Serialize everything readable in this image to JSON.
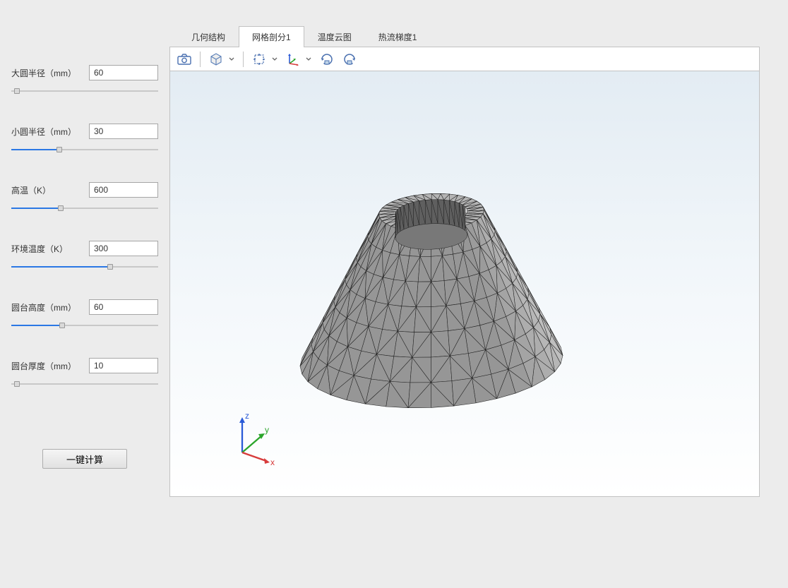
{
  "sidebar": {
    "params": [
      {
        "label": "大圆半径（mm）",
        "value": "60",
        "slider_pct": 2,
        "active": false
      },
      {
        "label": "小圆半径（mm）",
        "value": "30",
        "slider_pct": 32,
        "active": true
      },
      {
        "label": "高温（K）",
        "value": "600",
        "slider_pct": 33,
        "active": true
      },
      {
        "label": "环境温度（K）",
        "value": "300",
        "slider_pct": 68,
        "active": true
      },
      {
        "label": "圆台高度（mm）",
        "value": "60",
        "slider_pct": 34,
        "active": true
      },
      {
        "label": "圆台厚度（mm）",
        "value": "10",
        "slider_pct": 2,
        "active": false
      }
    ],
    "compute_label": "一键计算"
  },
  "tabs": {
    "items": [
      {
        "label": "几何结构",
        "active": false
      },
      {
        "label": "网格剖分1",
        "active": true
      },
      {
        "label": "温度云图",
        "active": false
      },
      {
        "label": "热流梯度1",
        "active": false
      }
    ]
  },
  "toolbar": {
    "icons": [
      {
        "name": "camera-icon",
        "dropdown": false
      },
      {
        "name": "cube-view-icon",
        "dropdown": true
      },
      {
        "name": "fit-view-icon",
        "dropdown": true
      },
      {
        "name": "axes-icon",
        "dropdown": true
      },
      {
        "name": "rotate-left-icon",
        "dropdown": false
      },
      {
        "name": "rotate-right-icon",
        "dropdown": false
      }
    ]
  },
  "viewport": {
    "axes": {
      "x": "x",
      "y": "y",
      "z": "z"
    }
  }
}
